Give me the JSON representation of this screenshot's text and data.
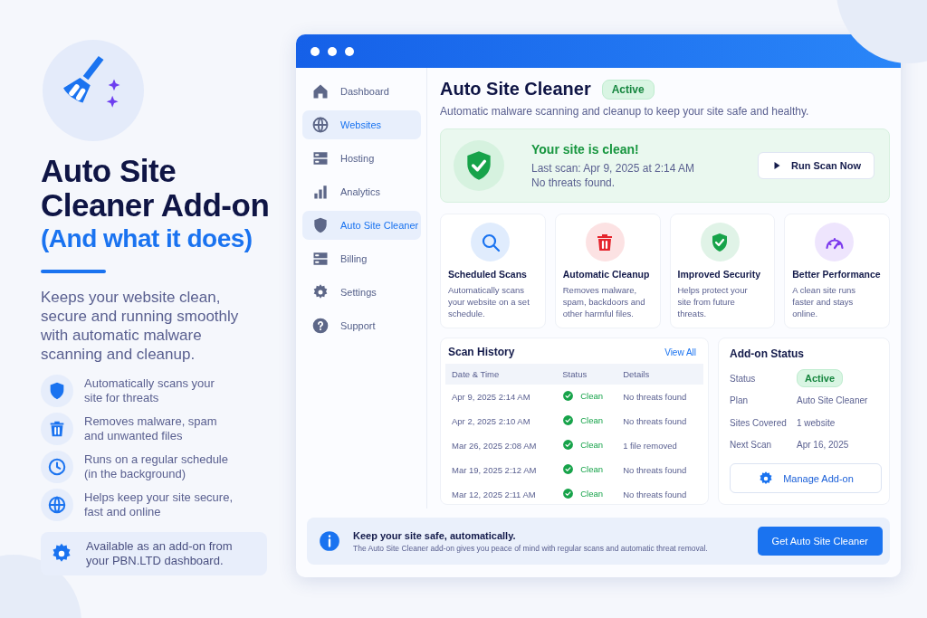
{
  "promo": {
    "title": "Auto Site Cleaner Add-on",
    "subtitle": "(And what it does)",
    "description": "Keeps your website clean, secure and running smoothly with automatic malware scanning and cleanup.",
    "features": [
      {
        "text": "Automatically scans your site for threats"
      },
      {
        "text": "Removes malware, spam and unwanted files"
      },
      {
        "text": "Runs on a regular schedule (in the background)"
      },
      {
        "text": "Helps keep your site secure, fast and online"
      }
    ],
    "note": "Available as an add-on from your PBN.LTD dashboard."
  },
  "sidebar": {
    "items": [
      {
        "label": "Dashboard",
        "selected": false
      },
      {
        "label": "Websites",
        "selected": true
      },
      {
        "label": "Hosting",
        "selected": false
      },
      {
        "label": "Analytics",
        "selected": false
      },
      {
        "label": "Auto Site Cleaner",
        "selected": true
      },
      {
        "label": "Billing",
        "selected": false
      },
      {
        "label": "Settings",
        "selected": false
      },
      {
        "label": "Support",
        "selected": false
      }
    ]
  },
  "header": {
    "title": "Auto Site Cleaner",
    "badge": "Active",
    "description": "Automatic malware scanning and cleanup to keep your site safe and healthy."
  },
  "status_card": {
    "title": "Your site is clean!",
    "last_scan": "Last scan: Apr 9, 2025 at 2:14 AM",
    "threats": "No threats found.",
    "button": "Run Scan Now"
  },
  "features": [
    {
      "title": "Scheduled Scans",
      "text": "Automatically scans your website on a set schedule.",
      "color": "#1a73f0"
    },
    {
      "title": "Automatic Cleanup",
      "text": "Removes malware, spam, backdoors and other harmful files.",
      "color": "#e5242c"
    },
    {
      "title": "Improved Security",
      "text": "Helps protect your site from future threats.",
      "color": "#17a34a"
    },
    {
      "title": "Better Performance",
      "text": "A clean site runs faster and stays online.",
      "color": "#7c3aed"
    }
  ],
  "scan_history": {
    "title": "Scan History",
    "link": "View All",
    "columns": [
      "Date & Time",
      "Status",
      "Details"
    ],
    "rows": [
      {
        "date": "Apr 9, 2025 2:14 AM",
        "status": "Clean",
        "details": "No threats found"
      },
      {
        "date": "Apr 2, 2025 2:10 AM",
        "status": "Clean",
        "details": "No threats found"
      },
      {
        "date": "Mar 26, 2025 2:08 AM",
        "status": "Clean",
        "details": "1 file removed"
      },
      {
        "date": "Mar 19, 2025 2:12 AM",
        "status": "Clean",
        "details": "No threats found"
      },
      {
        "date": "Mar 12, 2025 2:11 AM",
        "status": "Clean",
        "details": "No threats found"
      }
    ]
  },
  "addon_status": {
    "title": "Add-on Status",
    "rows": [
      {
        "label": "Status",
        "value": "Active",
        "kind": "badge"
      },
      {
        "label": "Plan",
        "value": "Auto Site Cleaner",
        "kind": "text"
      },
      {
        "label": "Sites Covered",
        "value": "1 website",
        "kind": "text"
      },
      {
        "label": "Next Scan",
        "value": "Apr 16, 2025",
        "kind": "text"
      }
    ],
    "button": "Manage Add-on"
  },
  "banner": {
    "title": "Keep your site safe, automatically.",
    "text": "The Auto Site Cleaner add-on gives you peace of mind with regular scans and automatic threat removal.",
    "button": "Get Auto Site Cleaner"
  }
}
